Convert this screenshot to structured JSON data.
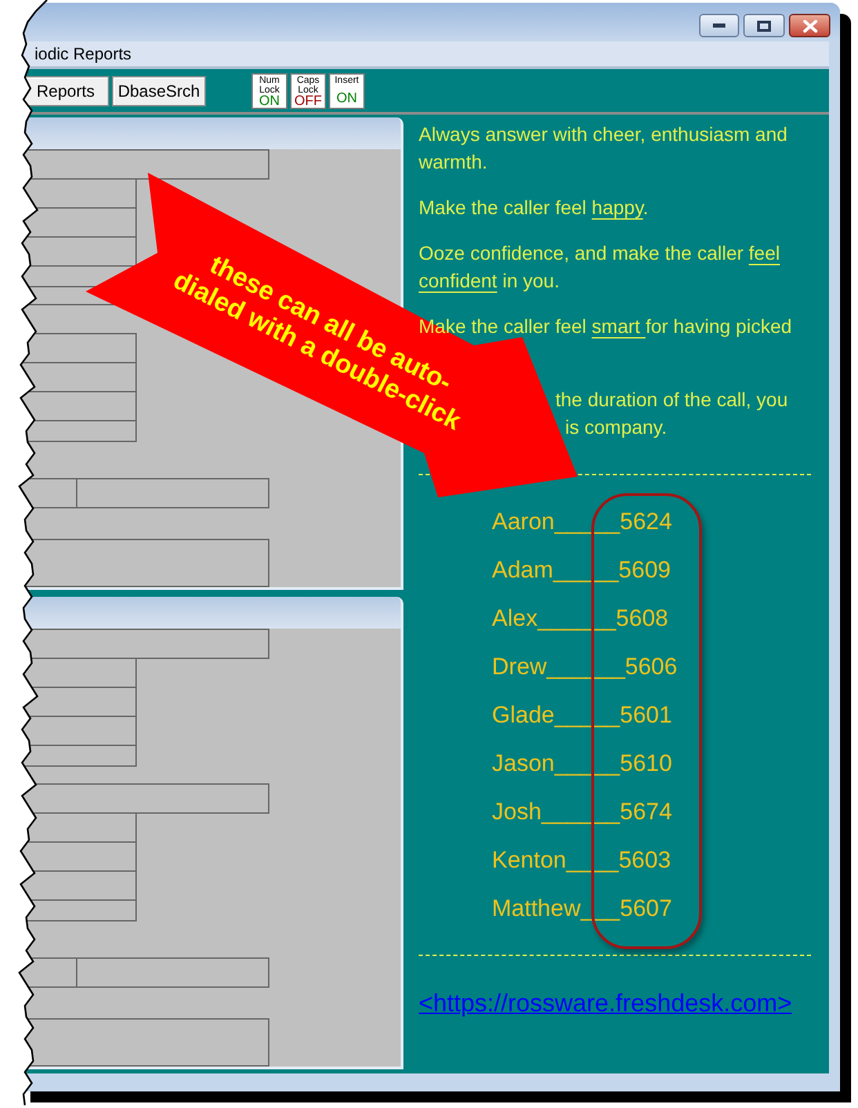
{
  "menu_bar": {
    "items": [
      {
        "label": "iodic Reports"
      }
    ]
  },
  "toolbar": {
    "buttons": [
      {
        "label": "Reports"
      },
      {
        "label": "DbaseSrch"
      }
    ],
    "indicators": [
      {
        "label": "Num Lock",
        "value": "ON",
        "on": true
      },
      {
        "label": "Caps Lock",
        "value": "OFF",
        "on": false
      },
      {
        "label": "Insert",
        "value": "ON",
        "on": true
      }
    ]
  },
  "info_panel": {
    "paragraphs": [
      {
        "kind": "text",
        "segments": [
          {
            "text": "Always answer with cheer, enthusiasm and warmth.",
            "underline": false
          }
        ]
      },
      {
        "kind": "text",
        "segments": [
          {
            "text": "Make the caller feel ",
            "underline": false
          },
          {
            "text": "happy",
            "underline": true
          },
          {
            "text": ".",
            "underline": false
          }
        ]
      },
      {
        "kind": "text",
        "segments": [
          {
            "text": "Ooze confidence, and make the caller ",
            "underline": false
          },
          {
            "text": "feel confident",
            "underline": true
          },
          {
            "text": " in you.",
            "underline": false
          }
        ]
      },
      {
        "kind": "text",
        "segments": [
          {
            "text": "Make the caller feel ",
            "underline": false
          },
          {
            "text": "smart ",
            "underline": true
          },
          {
            "text": "for having picked",
            "underline": false
          }
        ]
      },
      {
        "kind": "covered",
        "lines": [
          "the duration of the call, you",
          "is company."
        ]
      }
    ],
    "extensions": [
      "Aaron_____5624",
      "Adam_____5609",
      "Alex______5608",
      "Drew______5606",
      "Glade_____5601",
      "Jason_____5610",
      "Josh______5674",
      "Kenton____5603",
      "Matthew___5607"
    ],
    "link": "<https://rossware.freshdesk.com>"
  },
  "callout": {
    "lines": [
      "these can all be auto-",
      "dialed with a double-click"
    ]
  }
}
